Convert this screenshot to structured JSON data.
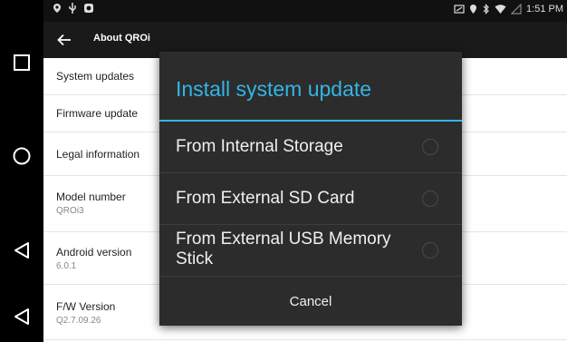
{
  "nav": {
    "icons": [
      "recents-square-icon",
      "home-circle-icon",
      "back-triangle-icon",
      "back-outline-icon"
    ]
  },
  "status_bar": {
    "time": "1:51 PM"
  },
  "app_bar": {
    "title": "About QROi"
  },
  "settings": {
    "items": [
      {
        "title": "System updates",
        "subtitle": ""
      },
      {
        "title": "Firmware update",
        "subtitle": ""
      },
      {
        "title": "Legal information",
        "subtitle": ""
      },
      {
        "title": "Model number",
        "subtitle": "QROi3"
      },
      {
        "title": "Android version",
        "subtitle": "6.0.1"
      },
      {
        "title": "F/W Version",
        "subtitle": "Q2.7.09.26"
      }
    ]
  },
  "dialog": {
    "title": "Install system update",
    "options": [
      {
        "label": "From Internal Storage",
        "selected": false
      },
      {
        "label": "From External SD Card",
        "selected": false
      },
      {
        "label": "From External USB Memory Stick",
        "selected": false
      }
    ],
    "cancel_label": "Cancel",
    "accent_color": "#33b5e5"
  }
}
